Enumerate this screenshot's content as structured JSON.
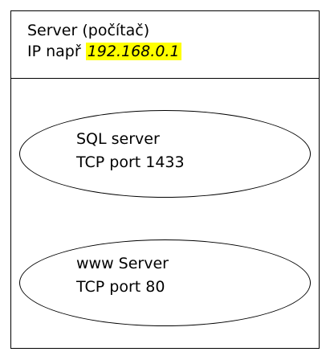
{
  "colors": {
    "line": "#000000",
    "background": "#ffffff",
    "ip_highlight": "#ffff00"
  },
  "server": {
    "title": "Server (počítač)",
    "ip_prefix": "IP např ",
    "ip_value": "192.168.0.1"
  },
  "services": [
    {
      "name": "SQL server",
      "port": "TCP port 1433"
    },
    {
      "name": "www Server",
      "port": "TCP port 80"
    }
  ]
}
